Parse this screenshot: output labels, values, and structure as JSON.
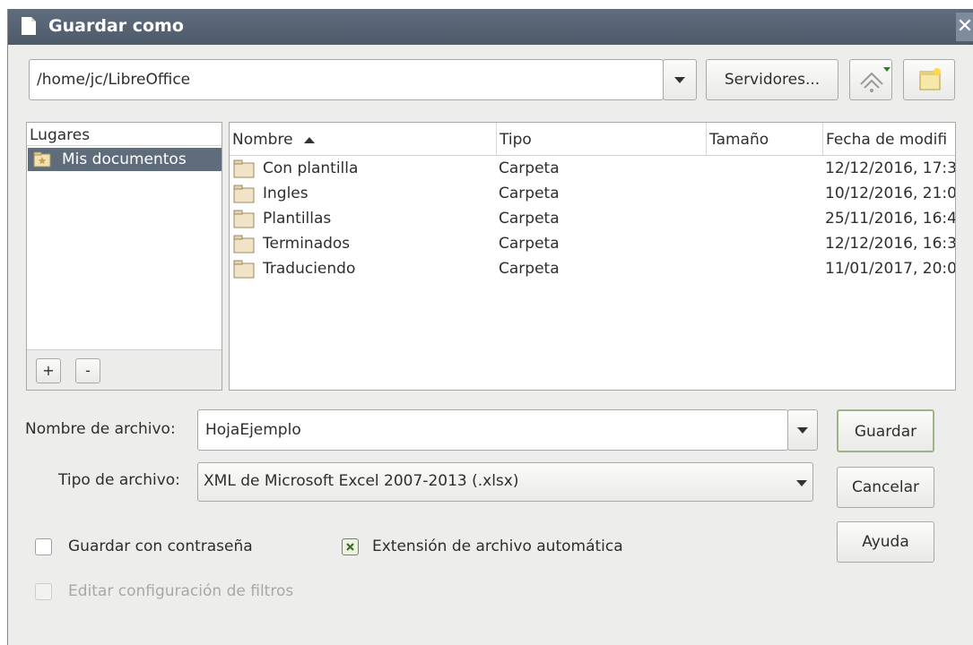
{
  "window": {
    "title": "Guardar como",
    "close_glyph": "✕"
  },
  "path_bar": {
    "value": "/home/jc/LibreOffice",
    "servers_label": "Servidores..."
  },
  "places": {
    "header": "Lugares",
    "items": [
      {
        "label": "Mis documentos",
        "icon": "favorite-folder-icon"
      }
    ],
    "add_label": "+",
    "remove_label": "-"
  },
  "files": {
    "columns": [
      "Nombre",
      "Tipo",
      "Tamaño",
      "Fecha de modifi"
    ],
    "rows": [
      {
        "name": "Con plantilla",
        "type": "Carpeta",
        "size": "",
        "date": "12/12/2016, 17:3"
      },
      {
        "name": "Ingles",
        "type": "Carpeta",
        "size": "",
        "date": "10/12/2016, 21:0"
      },
      {
        "name": "Plantillas",
        "type": "Carpeta",
        "size": "",
        "date": "25/11/2016, 16:4"
      },
      {
        "name": "Terminados",
        "type": "Carpeta",
        "size": "",
        "date": "12/12/2016, 16:3"
      },
      {
        "name": "Traduciendo",
        "type": "Carpeta",
        "size": "",
        "date": "11/01/2017, 20:0"
      }
    ]
  },
  "filename": {
    "label": "Nombre de archivo:",
    "value": "HojaEjemplo"
  },
  "filetype": {
    "label": "Tipo de archivo:",
    "value": "XML de Microsoft Excel 2007-2013 (.xlsx)"
  },
  "options": {
    "password": {
      "label": "Guardar con contraseña",
      "checked": false
    },
    "auto_extension": {
      "label": "Extensión de archivo automática",
      "checked": true
    },
    "edit_filters": {
      "label": "Editar configuración de filtros",
      "checked": false,
      "enabled": false
    }
  },
  "buttons": {
    "save": "Guardar",
    "cancel": "Cancelar",
    "help": "Ayuda"
  },
  "colors": {
    "titlebar": "#55626f",
    "selection": "#5e6c7c",
    "accent_check": "#6b8d52"
  }
}
